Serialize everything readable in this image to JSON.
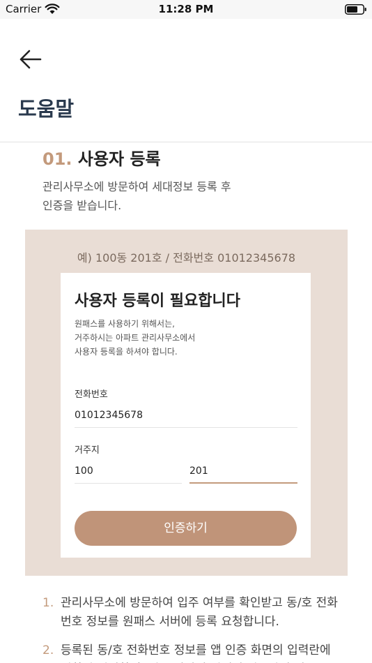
{
  "status_bar": {
    "carrier": "Carrier",
    "time": "11:28 PM",
    "icons": [
      "wifi-icon",
      "battery-icon"
    ]
  },
  "header": {
    "back_icon": "arrow-left-icon",
    "title": "도움말"
  },
  "section": {
    "number": "01.",
    "title": "사용자 등록",
    "description_lines": [
      "관리사무소에 방문하여 세대정보 등록 후",
      "인증을 받습니다."
    ]
  },
  "example": {
    "caption": "예) 100동 201호 / 전화번호 01012345678",
    "card": {
      "title": "사용자 등록이 필요합니다",
      "description_lines": [
        "원패스를 사용하기 위해서는,",
        "거주하시는 아파트 관리사무소에서",
        "사용자 등록을 하셔야 합니다."
      ],
      "phone": {
        "label": "전화번호",
        "value": "01012345678"
      },
      "residence": {
        "label": "거주지",
        "building": "100",
        "unit": "201"
      },
      "submit_label": "인증하기"
    }
  },
  "steps": [
    {
      "num": "1.",
      "text": "관리사무소에 방문하여 입주 여부를 확인받고 동/호 전화번호 정보를 원패스 서버에 등록 요청합니다."
    },
    {
      "num": "2.",
      "text": "등록된 동/호 전화번호 정보를 앱 인증 화면의 입력란에 정확히 입력한 후 인증 단말기 위에서 인증하기 버"
    }
  ],
  "colors": {
    "accent": "#c39a7c",
    "button": "#c09479",
    "panel": "#e9ddd5",
    "title": "#2a3a4e"
  }
}
